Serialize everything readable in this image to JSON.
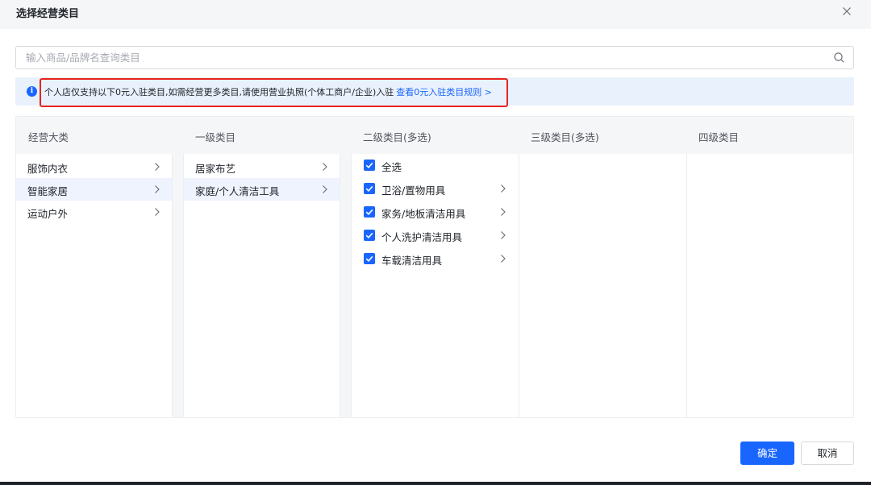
{
  "modal": {
    "title": "选择经营类目",
    "close_icon": "close-icon"
  },
  "search": {
    "placeholder": "输入商品/品牌名查询类目",
    "value": "",
    "icon": "search-icon"
  },
  "notice": {
    "icon": "info-icon",
    "icon_glyph": "i",
    "text": "个人店仅支持以下0元入驻类目,如需经营更多类目,请使用营业执照(个体工商户/企业)入驻",
    "link_text": "查看0元入驻类目规则 >",
    "highlight_color": "#e8231f"
  },
  "columns": {
    "headers": [
      "经营大类",
      "一级类目",
      "二级类目(多选)",
      "三级类目(多选)",
      "四级类目"
    ],
    "business": [
      {
        "label": "服饰内衣",
        "selected": false
      },
      {
        "label": "智能家居",
        "selected": true
      },
      {
        "label": "运动户外",
        "selected": false
      }
    ],
    "level1": [
      {
        "label": "居家布艺",
        "selected": false
      },
      {
        "label": "家庭/个人清洁工具",
        "selected": true
      }
    ],
    "level2": [
      {
        "label": "全选",
        "checked": true,
        "has_children": false
      },
      {
        "label": "卫浴/置物用具",
        "checked": true,
        "has_children": true
      },
      {
        "label": "家务/地板清洁用具",
        "checked": true,
        "has_children": true
      },
      {
        "label": "个人洗护清洁用具",
        "checked": true,
        "has_children": true
      },
      {
        "label": "车载清洁用具",
        "checked": true,
        "has_children": true
      }
    ]
  },
  "footer": {
    "confirm_label": "确定",
    "cancel_label": "取消"
  },
  "colors": {
    "accent": "#1966ff",
    "selected_row": "#eef3fd",
    "notice_bg": "#e9f1fc"
  }
}
